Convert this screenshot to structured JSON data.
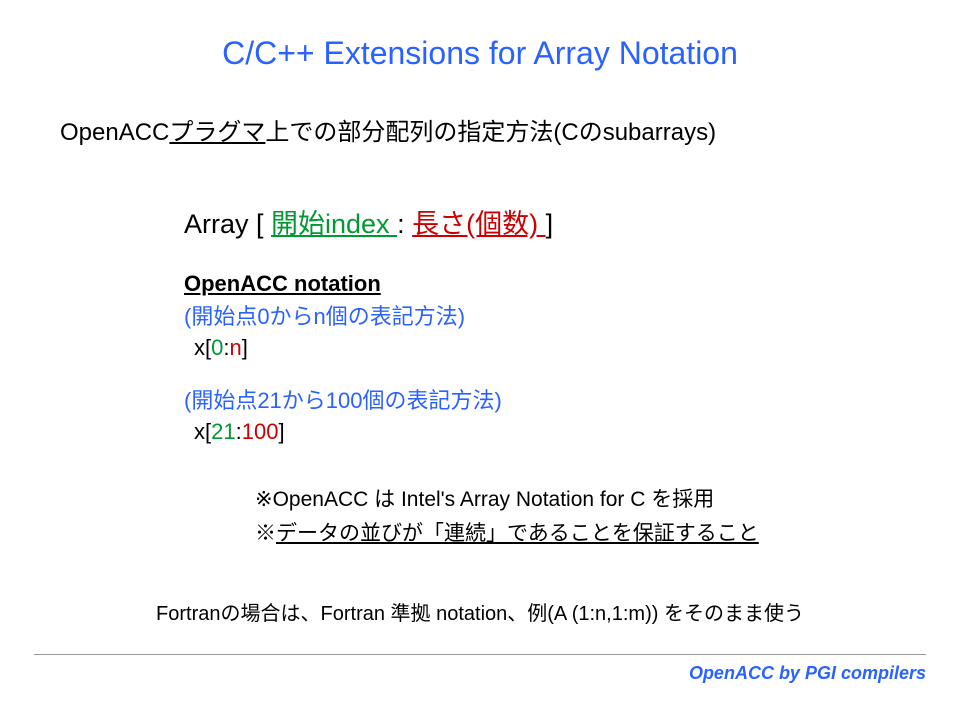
{
  "title": "C/C++ Extensions for Array Notation",
  "subtitle_prefix": "OpenACC",
  "subtitle_underlined": "プラグマ",
  "subtitle_suffix": "上での部分配列の指定方法(Cのsubarrays)",
  "syntax": {
    "array": "Array [ ",
    "start_index": "開始index ",
    "colon": ": ",
    "length": "長さ(個数) ",
    "close": "]"
  },
  "section_heading": "OpenACC notation ",
  "comment1": "(開始点0からn個の表記方法)",
  "example1": {
    "prefix": " x[",
    "start": "0",
    "colon": ":",
    "len": "n",
    "suffix": "]"
  },
  "comment2": "(開始点21から100個の表記方法)",
  "example2": {
    "prefix": " x[",
    "start": "21",
    "colon": ":",
    "len": "100",
    "suffix": "]"
  },
  "note1": "※OpenACC は Intel's Array Notation for C  を採用",
  "note2_prefix": "※",
  "note2_underlined": "データの並びが「連続」であることを保証すること",
  "fortran_note": "Fortranの場合は、Fortran 準拠 notation、例(A (1:n,1:m)) をそのまま使う",
  "footer": "OpenACC by PGI compilers"
}
